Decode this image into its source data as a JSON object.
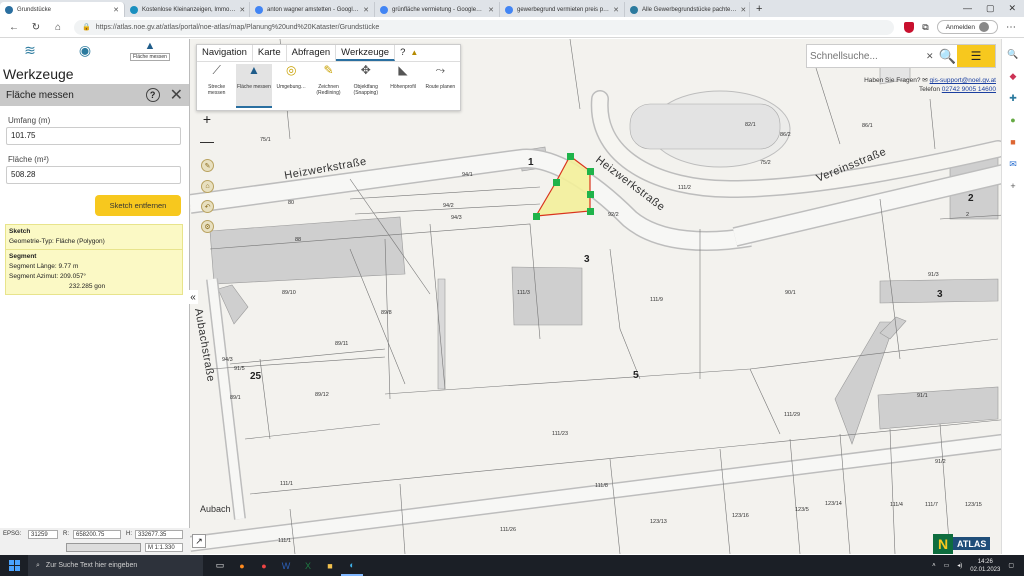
{
  "browser": {
    "tabs": [
      {
        "title": "Grundstücke",
        "active": true
      },
      {
        "title": "Kostenlose Kleinanzeigen, Immo…",
        "active": false
      },
      {
        "title": "anton wagner amstetten - Googl…",
        "active": false
      },
      {
        "title": "grünfläche vermietung - Google…",
        "active": false
      },
      {
        "title": "gewerbegrund vermieten preis p…",
        "active": false
      },
      {
        "title": "Alle Gewerbegrundstücke pachte…",
        "active": false
      }
    ],
    "url": "https://atlas.noe.gv.at/atlas/portal/noe-atlas/map/Planung%20und%20Kataster/Grundstücke",
    "login_label": "Anmelden"
  },
  "left_panel": {
    "top_tool_label": "Fläche messen",
    "title": "Werkzeuge",
    "section_title": "Fläche messen",
    "help_label": "?",
    "perimeter_label": "Umfang (m)",
    "perimeter_value": "101.75",
    "area_label": "Fläche (m²)",
    "area_value": "508.28",
    "sketch_button": "Sketch entfernen",
    "sketch_box": {
      "heading": "Sketch",
      "geometry": "Geometrie-Typ: Fläche (Polygon)"
    },
    "segment_box": {
      "heading": "Segment",
      "length": "Segment Länge:   9.77 m",
      "azimuth": "Segment Azimut: 209.057°",
      "gon": "232.285 gon"
    }
  },
  "status_bar": {
    "epsg_label": "EPSG:",
    "epsg_value": "31259",
    "r_label": "R:",
    "r_value": "658200.75",
    "h_label": "H:",
    "h_value": "332677.35",
    "scale": "M 1:1.330"
  },
  "toolbar": {
    "tabs": [
      "Navigation",
      "Karte",
      "Abfragen",
      "Werkzeuge",
      "?"
    ],
    "active_tab": "Werkzeuge",
    "tools": [
      {
        "label": "Strecke messen",
        "icon": "ruler-icon"
      },
      {
        "label": "Fläche messen",
        "icon": "area-icon"
      },
      {
        "label": "Umgebung…",
        "icon": "compass-icon"
      },
      {
        "label": "Zeichnen (Redlining)",
        "icon": "pencil-icon"
      },
      {
        "label": "Objektfang (Snapping)",
        "icon": "snap-icon"
      },
      {
        "label": "Höhenprofil",
        "icon": "profile-icon"
      },
      {
        "label": "Route planen",
        "icon": "route-icon"
      }
    ]
  },
  "search": {
    "placeholder": "Schnellsuche...",
    "support_question": "Haben Sie Fragen?",
    "support_email": "gis-support@noel.gv.at",
    "support_phone_label": "Telefon",
    "support_phone": "02742 9005 14600"
  },
  "map": {
    "streets": [
      "Heizwerkstraße",
      "Heizwerkstraße",
      "Vereinsstraße",
      "Aubachstraße"
    ],
    "house_numbers": [
      "1",
      "2",
      "3",
      "3",
      "5",
      "25"
    ],
    "parcels": [
      "75/1",
      "82/1",
      "86/1",
      "75/2",
      "111/2",
      "94/1",
      "94/2",
      "94/3",
      "80",
      "88",
      "92/2",
      "111/3",
      "111/9",
      "90/1",
      "91/3",
      "89/10",
      "89/8",
      "89/11",
      "89/12",
      "89/1",
      "111/23",
      "111/29",
      "111/1",
      "111/8",
      "111/26",
      "123/13",
      "123/16",
      "123/5",
      "111/7",
      "94/3",
      "91/1",
      "91/2",
      "2",
      "111/1",
      "91/5",
      "86/2",
      "123/14",
      "123/15",
      "111/4"
    ],
    "attribution": "Aubach"
  },
  "logo": {
    "letter": "N",
    "text": "ATLAS"
  },
  "taskbar": {
    "search_placeholder": "Zur Suche Text hier eingeben",
    "time": "14:26",
    "date": "02.01.2023"
  },
  "colors": {
    "accent_yellow": "#f7c81e",
    "measure_fill": "#f3ef9a",
    "measure_line": "#d9341e",
    "vertex": "#1fb34a"
  }
}
